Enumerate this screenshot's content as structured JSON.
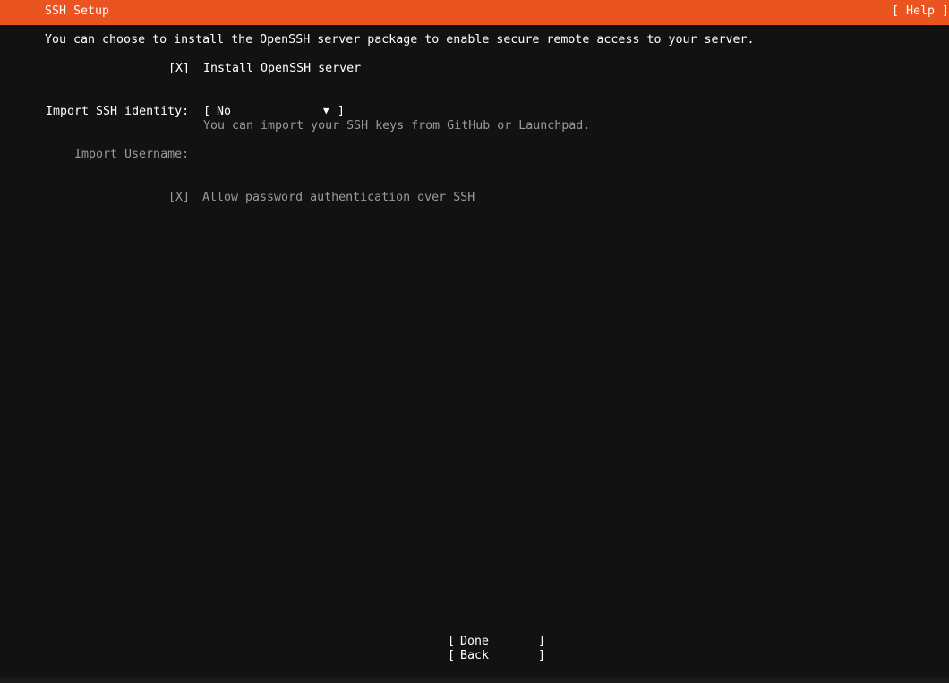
{
  "header": {
    "title": "SSH Setup",
    "help_button": "[ Help ]"
  },
  "intro_text": "You can choose to install the OpenSSH server package to enable secure remote access to your server.",
  "install_openssh": {
    "checkbox": "[X]",
    "label": "Install OpenSSH server"
  },
  "import_identity": {
    "label": "Import SSH identity:",
    "select_open": "[",
    "select_value": "No",
    "select_arrow": "▼",
    "select_close": "]",
    "help_text": "You can import your SSH keys from GitHub or Launchpad."
  },
  "import_username": {
    "label": "Import Username:"
  },
  "allow_password": {
    "checkbox": "[X]",
    "label": "Allow password authentication over SSH"
  },
  "buttons": {
    "done": {
      "open": "[",
      "label": "Done",
      "close": "]"
    },
    "back": {
      "open": "[",
      "label": "Back",
      "close": "]"
    }
  },
  "colors": {
    "accent": "#e95420",
    "background": "#121212",
    "text": "#ffffff",
    "dim_text": "#9a9a9a"
  }
}
